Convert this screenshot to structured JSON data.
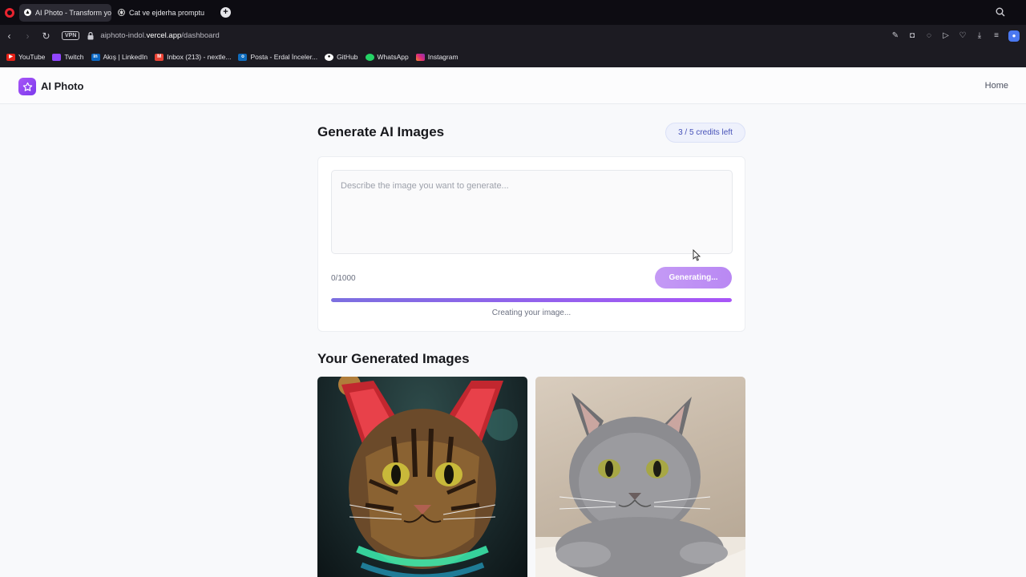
{
  "browser": {
    "tabs": [
      {
        "title": "AI Photo - Transform your",
        "active": true,
        "icon": "triangle-icon"
      },
      {
        "title": "Cat ve ejderha promptu",
        "active": false,
        "icon": "chatgpt-icon"
      }
    ],
    "url_prefix": "aiphoto-indol.",
    "url_domain": "vercel.app",
    "url_path": "/dashboard",
    "vpn_label": "VPN",
    "bookmarks": [
      {
        "label": "YouTube",
        "icon": "youtube-icon",
        "color": "#e62117"
      },
      {
        "label": "Twitch",
        "icon": "twitch-icon",
        "color": "#9146ff"
      },
      {
        "label": "Akış | LinkedIn",
        "icon": "linkedin-icon",
        "color": "#0a66c2"
      },
      {
        "label": "Inbox (213) - nextle...",
        "icon": "gmail-icon",
        "color": "#ea4335"
      },
      {
        "label": "Posta - Erdal İnceler...",
        "icon": "outlook-icon",
        "color": "#0f6cbd"
      },
      {
        "label": "GitHub",
        "icon": "github-icon",
        "color": "#ffffff"
      },
      {
        "label": "WhatsApp",
        "icon": "whatsapp-icon",
        "color": "#25d366"
      },
      {
        "label": "Instagram",
        "icon": "instagram-icon",
        "color": "#e1306c"
      }
    ]
  },
  "app": {
    "brand": "AI Photo",
    "nav_home": "Home",
    "accent": "#8b5cf6"
  },
  "generator": {
    "title": "Generate AI Images",
    "credits": "3 / 5 credits left",
    "prompt_placeholder": "Describe the image you want to generate...",
    "prompt_value": "",
    "char_count": "0/1000",
    "button_label": "Generating...",
    "progress_fraction": 1.0,
    "status_text": "Creating your image..."
  },
  "gallery": {
    "title": "Your Generated Images",
    "images": [
      {
        "description": "cyberpunk tabby cat with red glowing ears and green neon collar"
      },
      {
        "description": "grey british shorthair cat lying on a blanket"
      }
    ]
  }
}
